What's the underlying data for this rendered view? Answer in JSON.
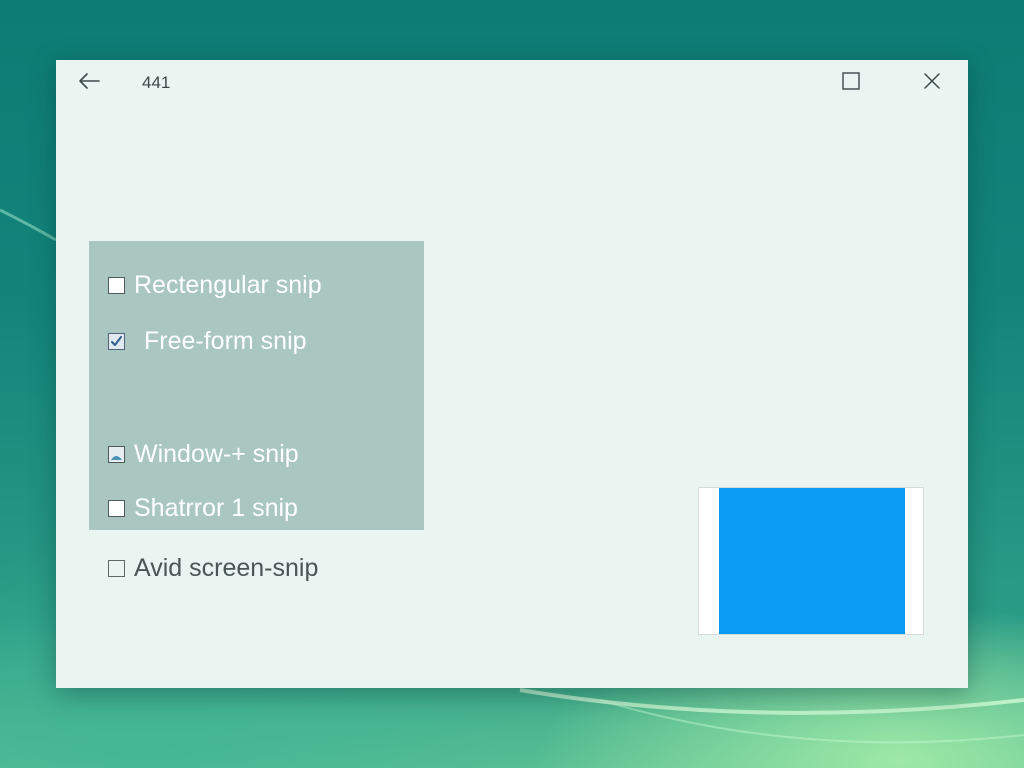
{
  "window": {
    "title": "441"
  },
  "options": [
    {
      "label": "Rectengular snip",
      "state": "unchecked"
    },
    {
      "label": "Free-form snip",
      "state": "checked"
    },
    {
      "label": "Window-+ snip",
      "state": "partial"
    },
    {
      "label": "Shatrror 1 snip",
      "state": "unchecked"
    },
    {
      "label": "Avid screen-snip",
      "state": "unchecked"
    }
  ],
  "icons": {
    "back": "arrow-left-icon",
    "maximize": "maximize-icon",
    "close": "close-icon"
  },
  "colors": {
    "panel": "#a9c7c0",
    "preview_fill": "#0b9bf5",
    "window_bg": "#eaf4f1"
  }
}
